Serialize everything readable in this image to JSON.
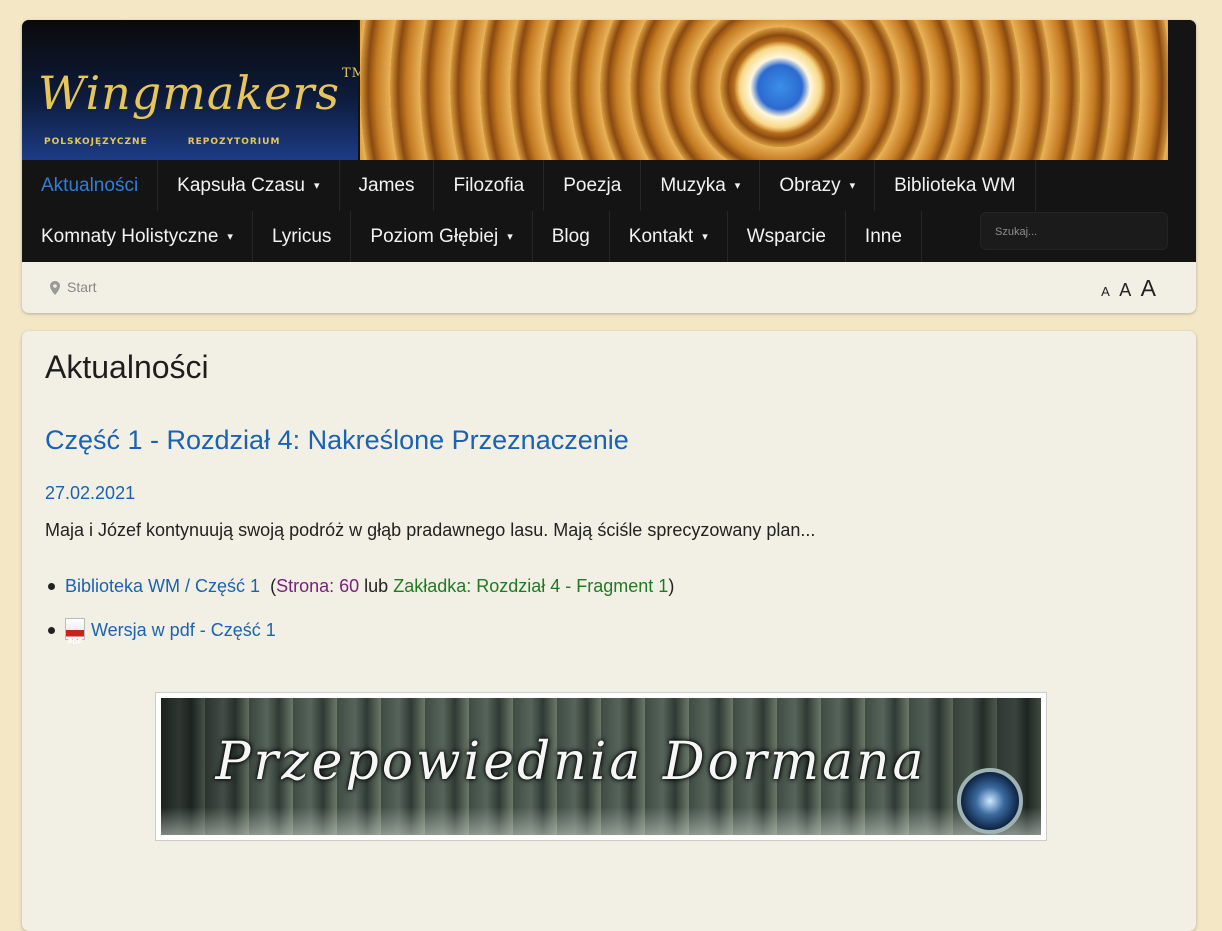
{
  "logo": {
    "title": "Wingmakers",
    "tm": "TM",
    "subtitle_left": "POLSKOJĘZYCZNE",
    "subtitle_right": "REPOZYTORIUM"
  },
  "nav": {
    "row1": [
      {
        "label": "Aktualności",
        "active": true,
        "dropdown": false
      },
      {
        "label": "Kapsuła Czasu",
        "dropdown": true
      },
      {
        "label": "James",
        "dropdown": false
      },
      {
        "label": "Filozofia",
        "dropdown": false
      },
      {
        "label": "Poezja",
        "dropdown": false
      },
      {
        "label": "Muzyka",
        "dropdown": true
      },
      {
        "label": "Obrazy",
        "dropdown": true
      },
      {
        "label": "Biblioteka WM",
        "dropdown": false
      }
    ],
    "row2": [
      {
        "label": "Komnaty Holistyczne",
        "dropdown": true
      },
      {
        "label": "Lyricus",
        "dropdown": false
      },
      {
        "label": "Poziom Głębiej",
        "dropdown": true
      },
      {
        "label": "Blog",
        "dropdown": false
      },
      {
        "label": "Kontakt",
        "dropdown": true
      },
      {
        "label": "Wsparcie",
        "dropdown": false
      },
      {
        "label": "Inne",
        "dropdown": false
      }
    ],
    "caret_icon": "chevron-down-icon"
  },
  "search": {
    "placeholder": "Szukaj..."
  },
  "breadcrumb": {
    "icon": "map-pin-icon",
    "label": "Start"
  },
  "font_sizer": [
    "A",
    "A",
    "A"
  ],
  "page": {
    "heading": "Aktualności"
  },
  "article": {
    "title": "Część 1 - Rozdział 4: Nakreślone Przeznaczenie",
    "date": "27.02.2021",
    "intro": "Maja i Józef kontynuują swoją podróż w głąb pradawnego lasu. Mają ściśle sprecyzowany plan...",
    "link1": {
      "text": "Biblioteka WM / Część 1",
      "open_paren": "(",
      "page_label": "Strona: 60",
      "or": "lub",
      "bookmark": "Zakładka: Rozdział 4 - Fragment 1",
      "close_paren": ")"
    },
    "link2": {
      "icon": "pdf-icon",
      "icon_text": "PDF",
      "text": "Wersja w pdf - Część 1"
    }
  },
  "banner": {
    "title": "Przepowiednia Dormana"
  },
  "colors": {
    "link": "#1a62b4",
    "nav_bg": "#141414",
    "active_nav": "#2f7fd6",
    "page_bg": "#f3e7c6",
    "card_bg": "#f2efe4",
    "purple": "#7a1e7a",
    "green": "#1f7a22"
  }
}
